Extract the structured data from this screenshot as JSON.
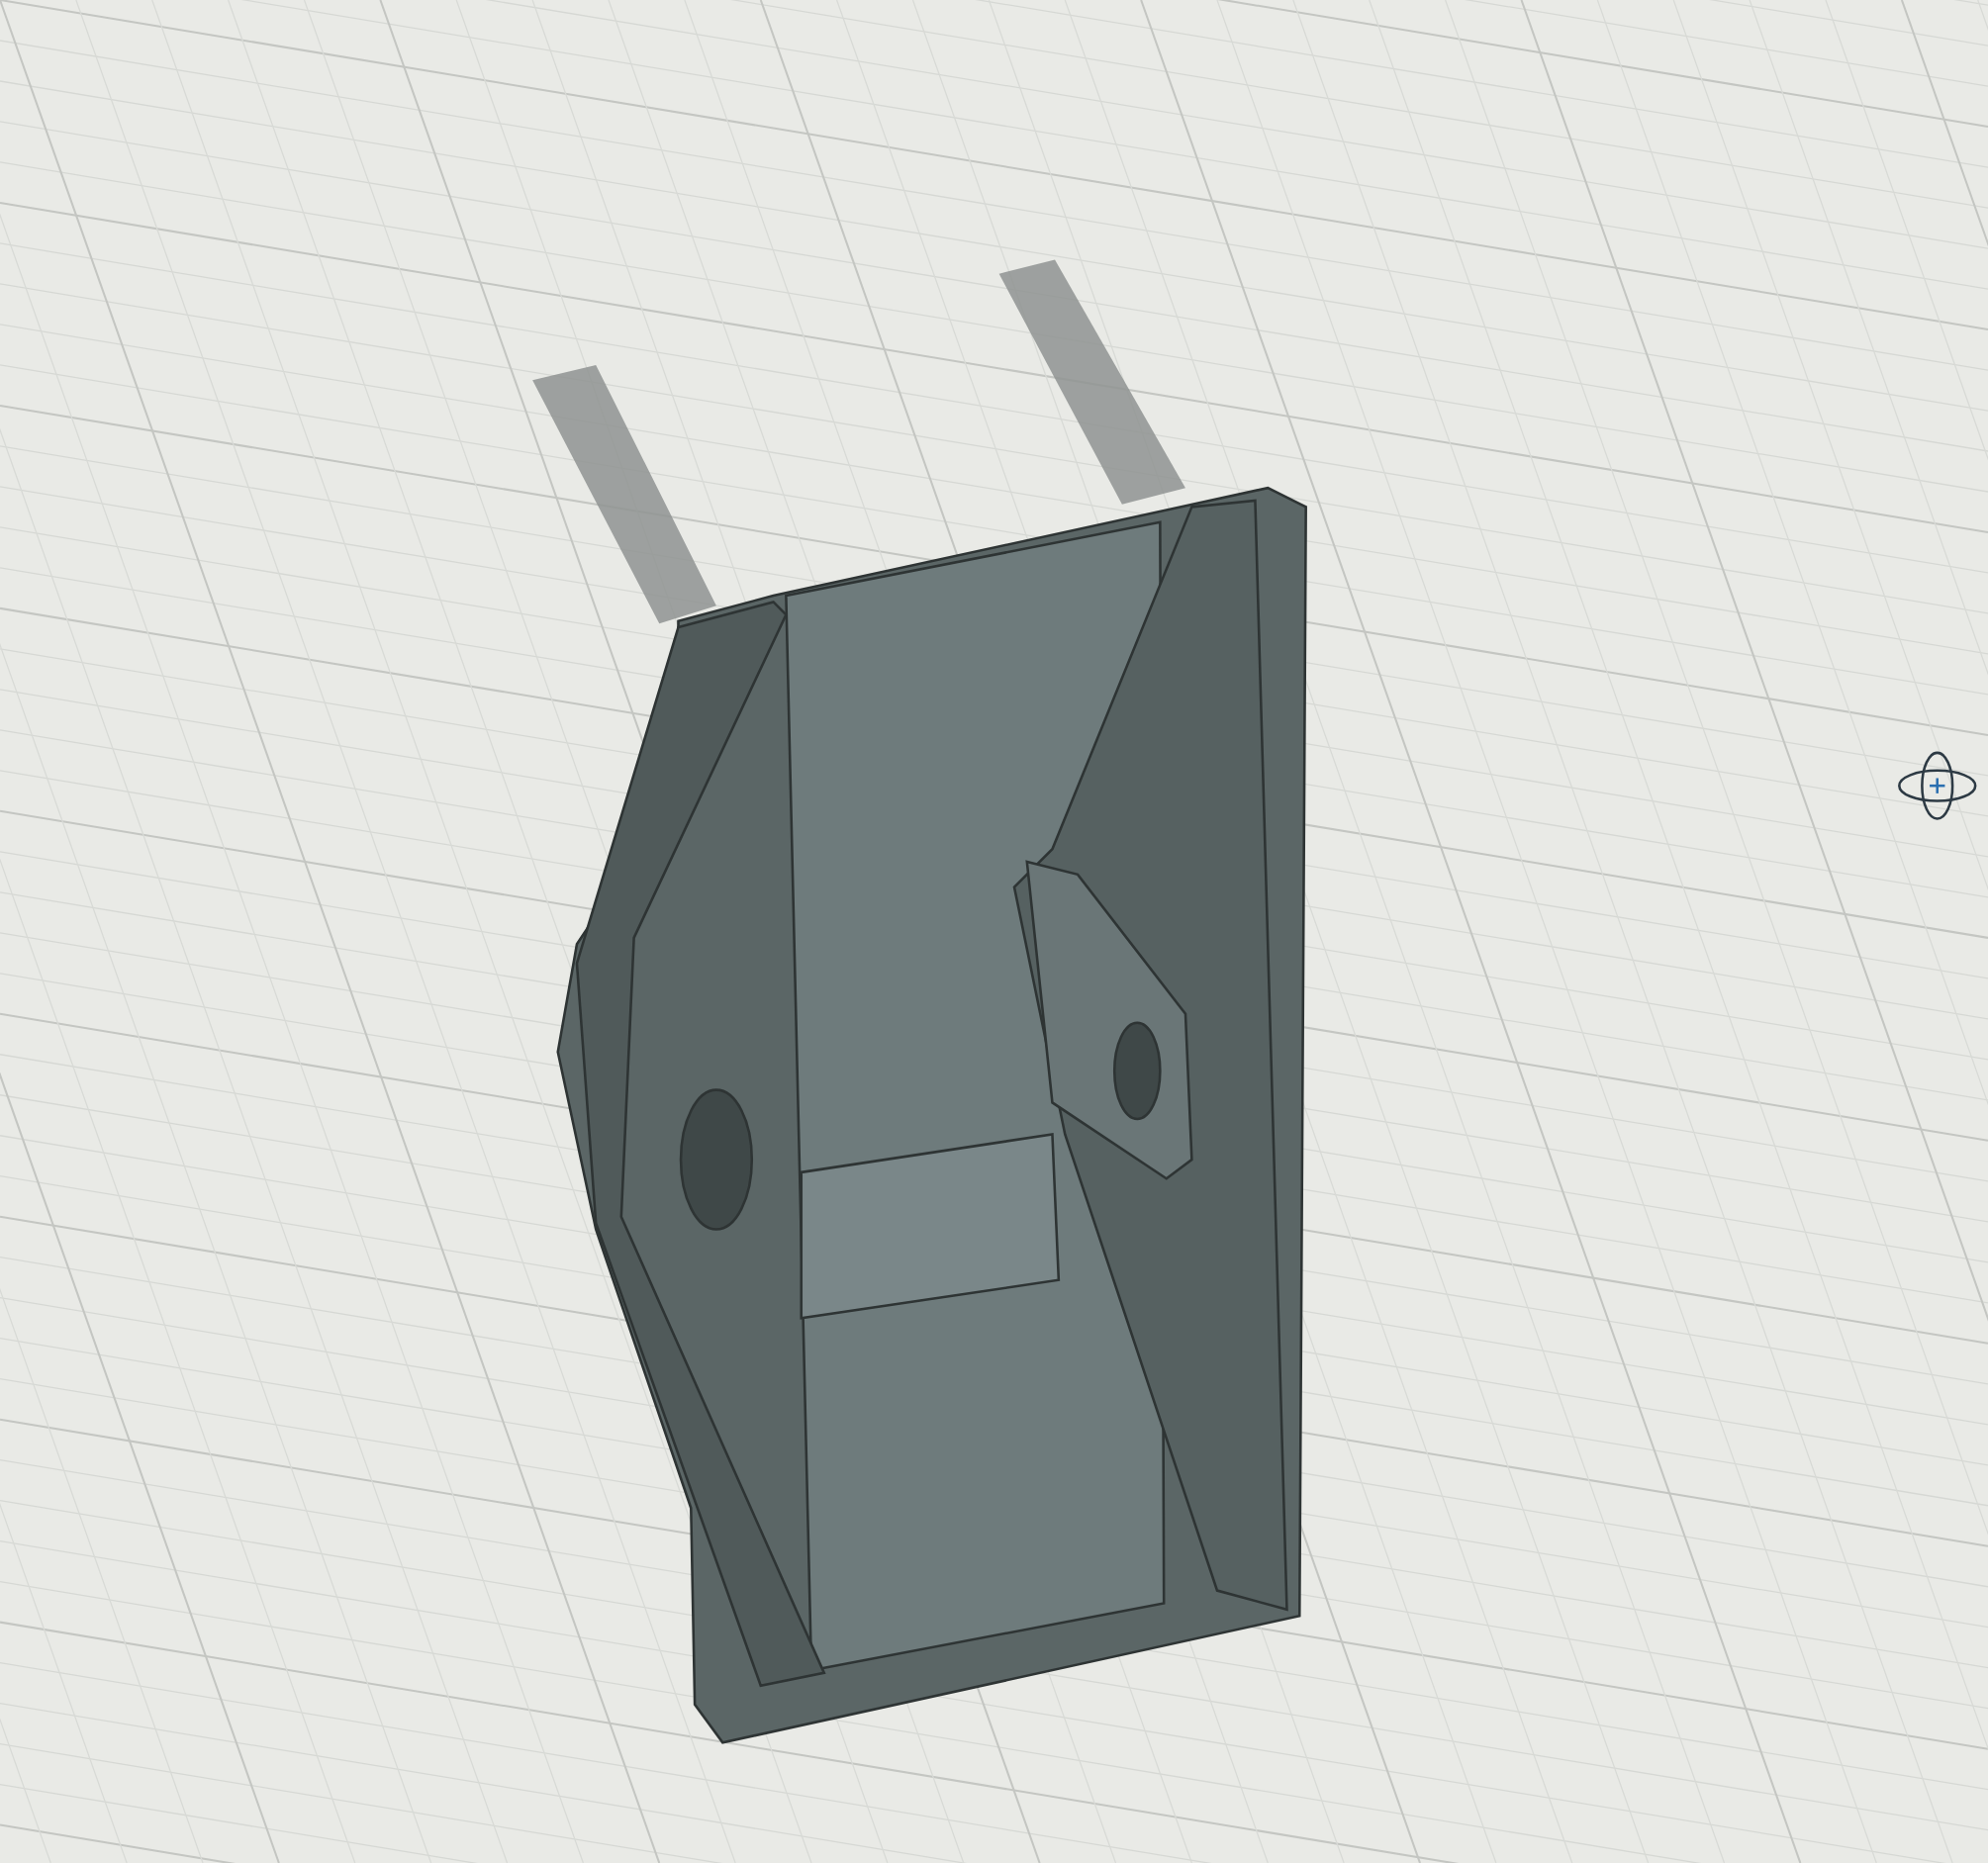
{
  "viewport": {
    "show_grid": true,
    "show_shadow": true
  },
  "cursor": {
    "kind": "orbit"
  }
}
